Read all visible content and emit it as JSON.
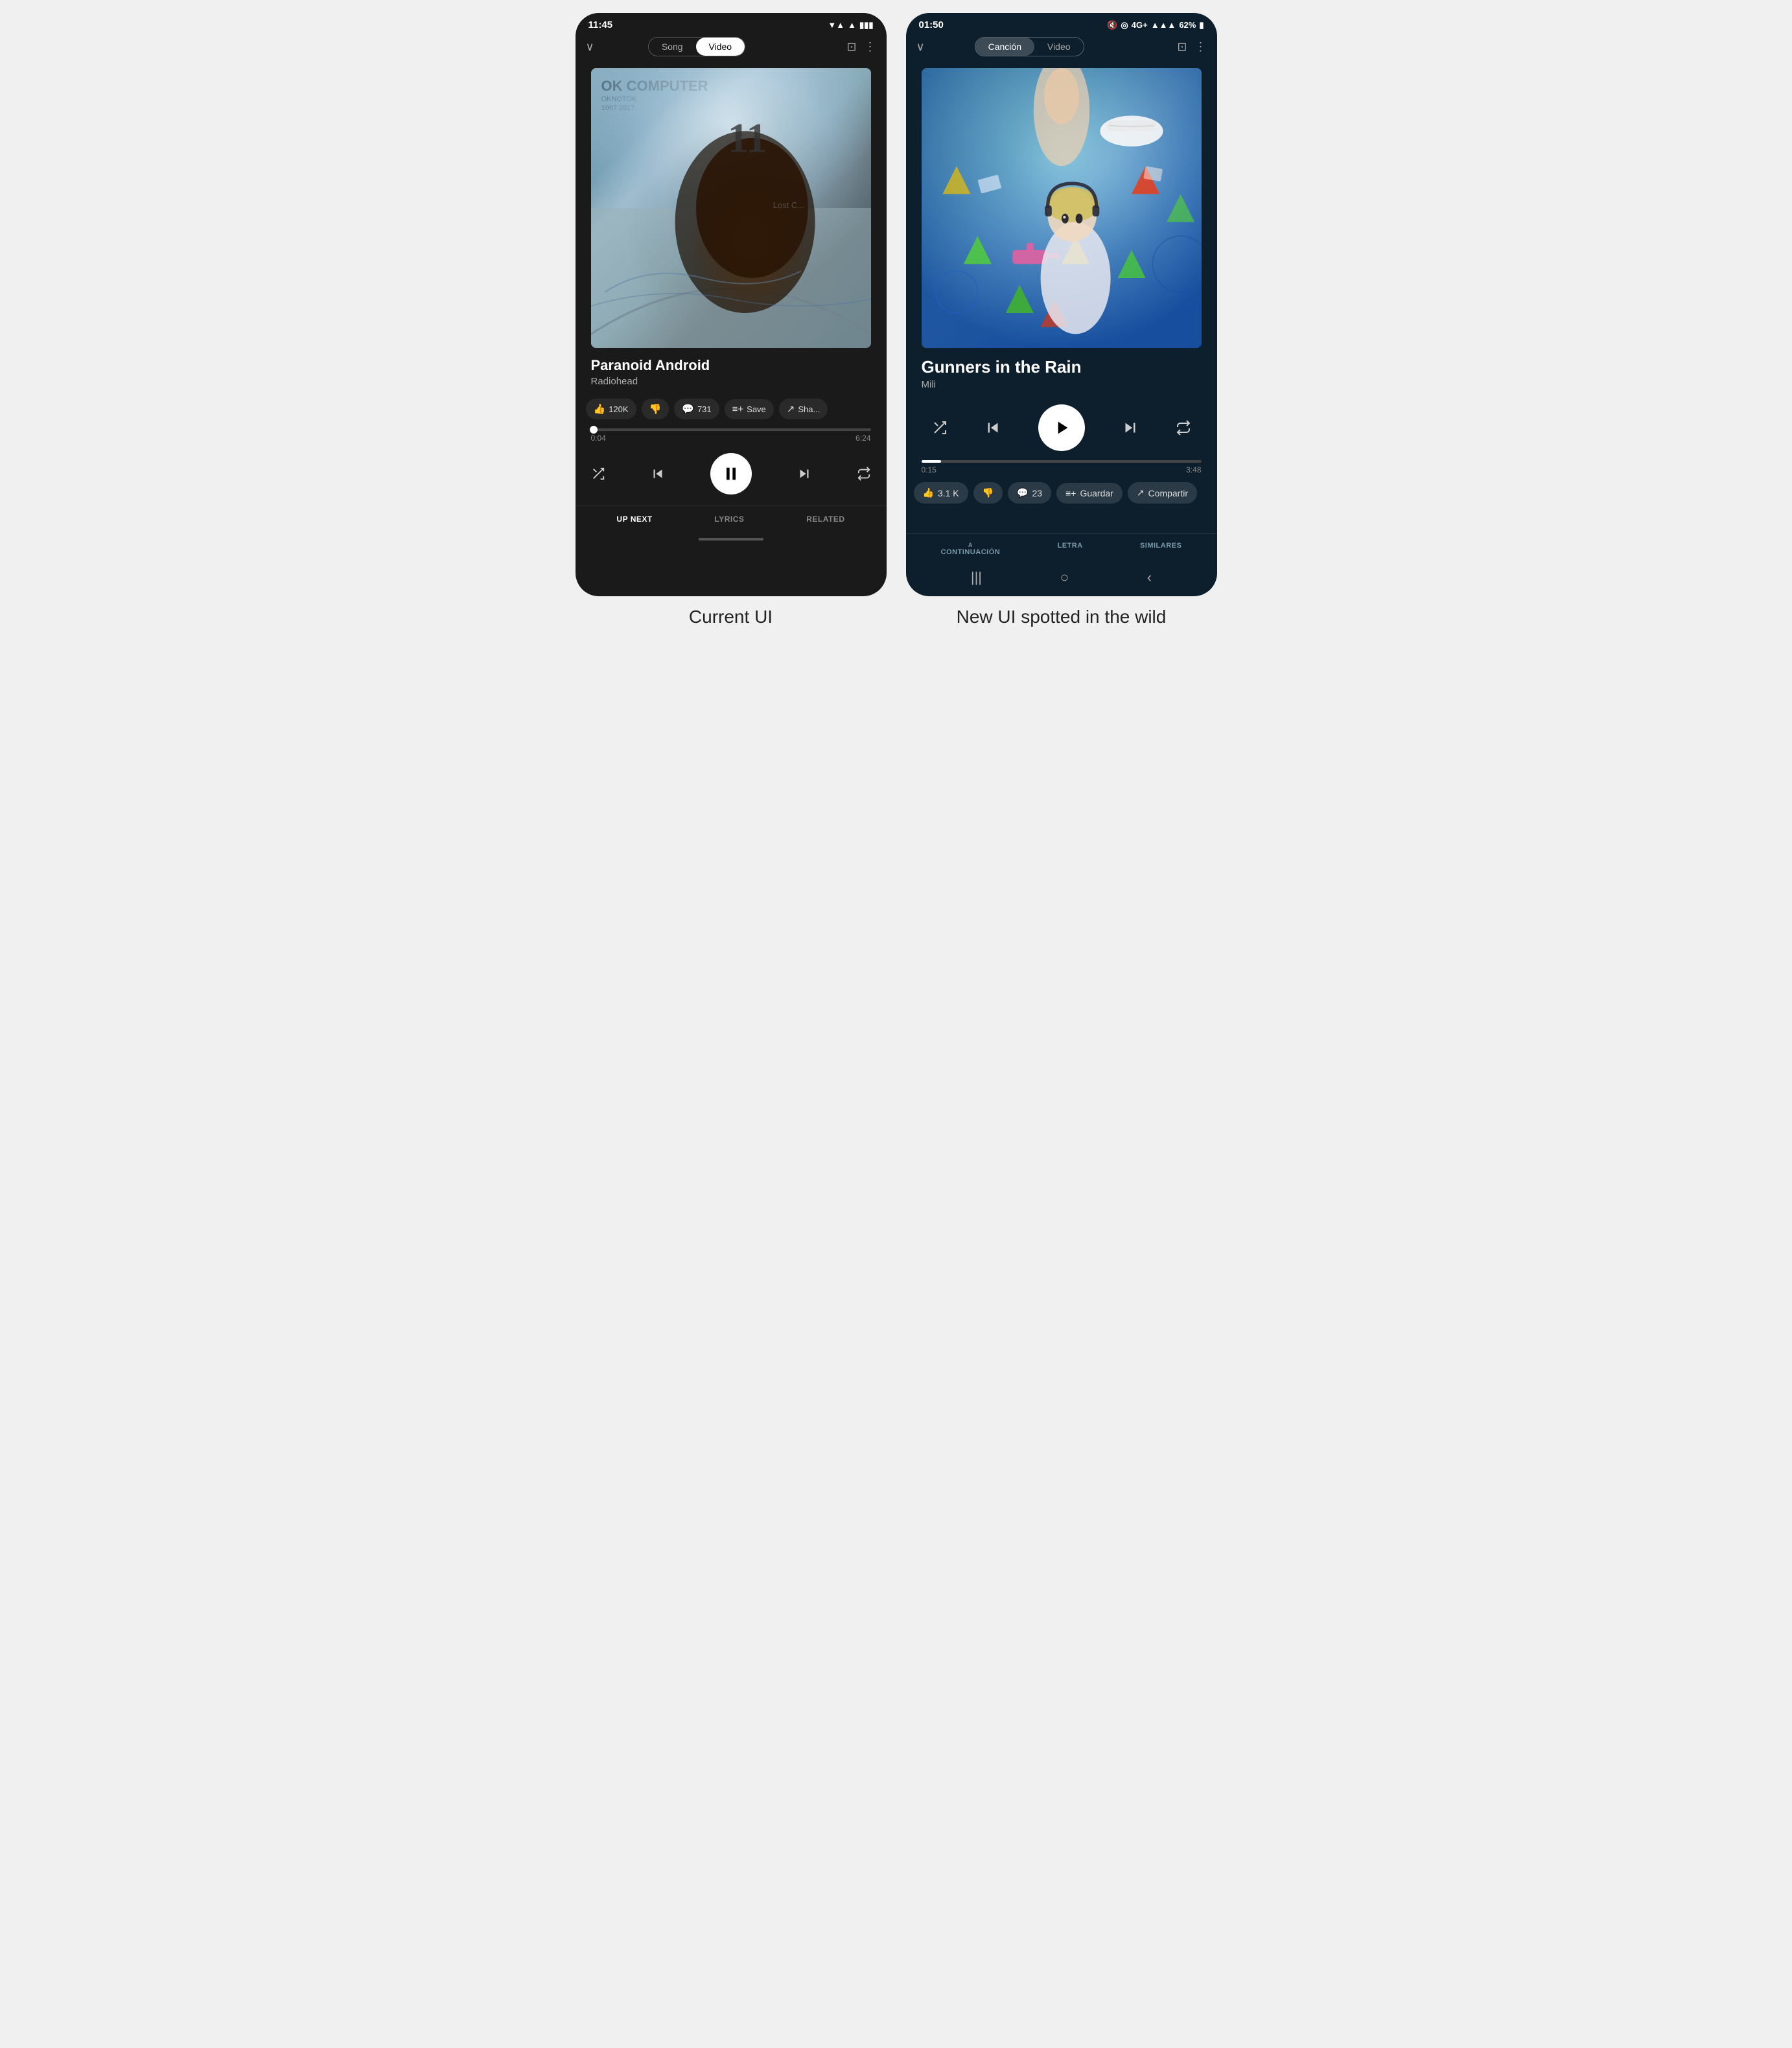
{
  "left_phone": {
    "status_bar": {
      "time": "11:45",
      "signal_icon": "▼▲",
      "wifi_icon": "▲",
      "battery_icon": "🔋"
    },
    "nav": {
      "chevron": "∨",
      "tab_song": "Song",
      "tab_video": "Video",
      "active_tab": "video",
      "cast_icon": "⊡",
      "more_icon": "⋮"
    },
    "song": {
      "title": "Paranoid Android",
      "artist": "Radiohead",
      "album": "OK COMPUTER",
      "album_sub": "OKNOTOK",
      "album_year": "1997 2017."
    },
    "actions": {
      "like_count": "120K",
      "comment_count": "731",
      "save_label": "Save",
      "share_label": "Sha..."
    },
    "progress": {
      "current": "0:04",
      "total": "6:24",
      "fill_percent": 1
    },
    "controls": {
      "shuffle": "⇄",
      "prev": "⏮",
      "play_pause": "⏸",
      "next": "⏭",
      "repeat": "⇄"
    },
    "bottom_tabs": [
      {
        "label": "UP NEXT",
        "active": true
      },
      {
        "label": "LYRICS",
        "active": false
      },
      {
        "label": "RELATED",
        "active": false
      }
    ],
    "label": "Current UI"
  },
  "right_phone": {
    "status_bar": {
      "time": "01:50",
      "mute_icon": "🔇",
      "network": "4G+",
      "signal": "▲▲▲",
      "battery_percent": "62%"
    },
    "nav": {
      "chevron": "∨",
      "tab_song": "Canción",
      "tab_video": "Video",
      "active_tab": "song",
      "cast_icon": "⊡",
      "more_icon": "⋮"
    },
    "song": {
      "title": "Gunners in the Rain",
      "artist": "Mili"
    },
    "actions": {
      "like_count": "3.1 K",
      "comment_count": "23",
      "save_label": "Guardar",
      "share_label": "Compartir"
    },
    "progress": {
      "current": "0:15",
      "total": "3:48",
      "fill_percent": 7
    },
    "controls": {
      "shuffle": "⇄",
      "prev": "⏮",
      "play": "▶",
      "next": "⏭",
      "repeat": "⇄"
    },
    "bottom_tabs": [
      {
        "label": "A\nCONTINUACIÓN",
        "active": false
      },
      {
        "label": "LETRA",
        "active": false
      },
      {
        "label": "SIMILARES",
        "active": false
      }
    ],
    "android_nav": {
      "menu": "|||",
      "home": "○",
      "back": "‹"
    },
    "label": "New UI spotted in the wild"
  }
}
